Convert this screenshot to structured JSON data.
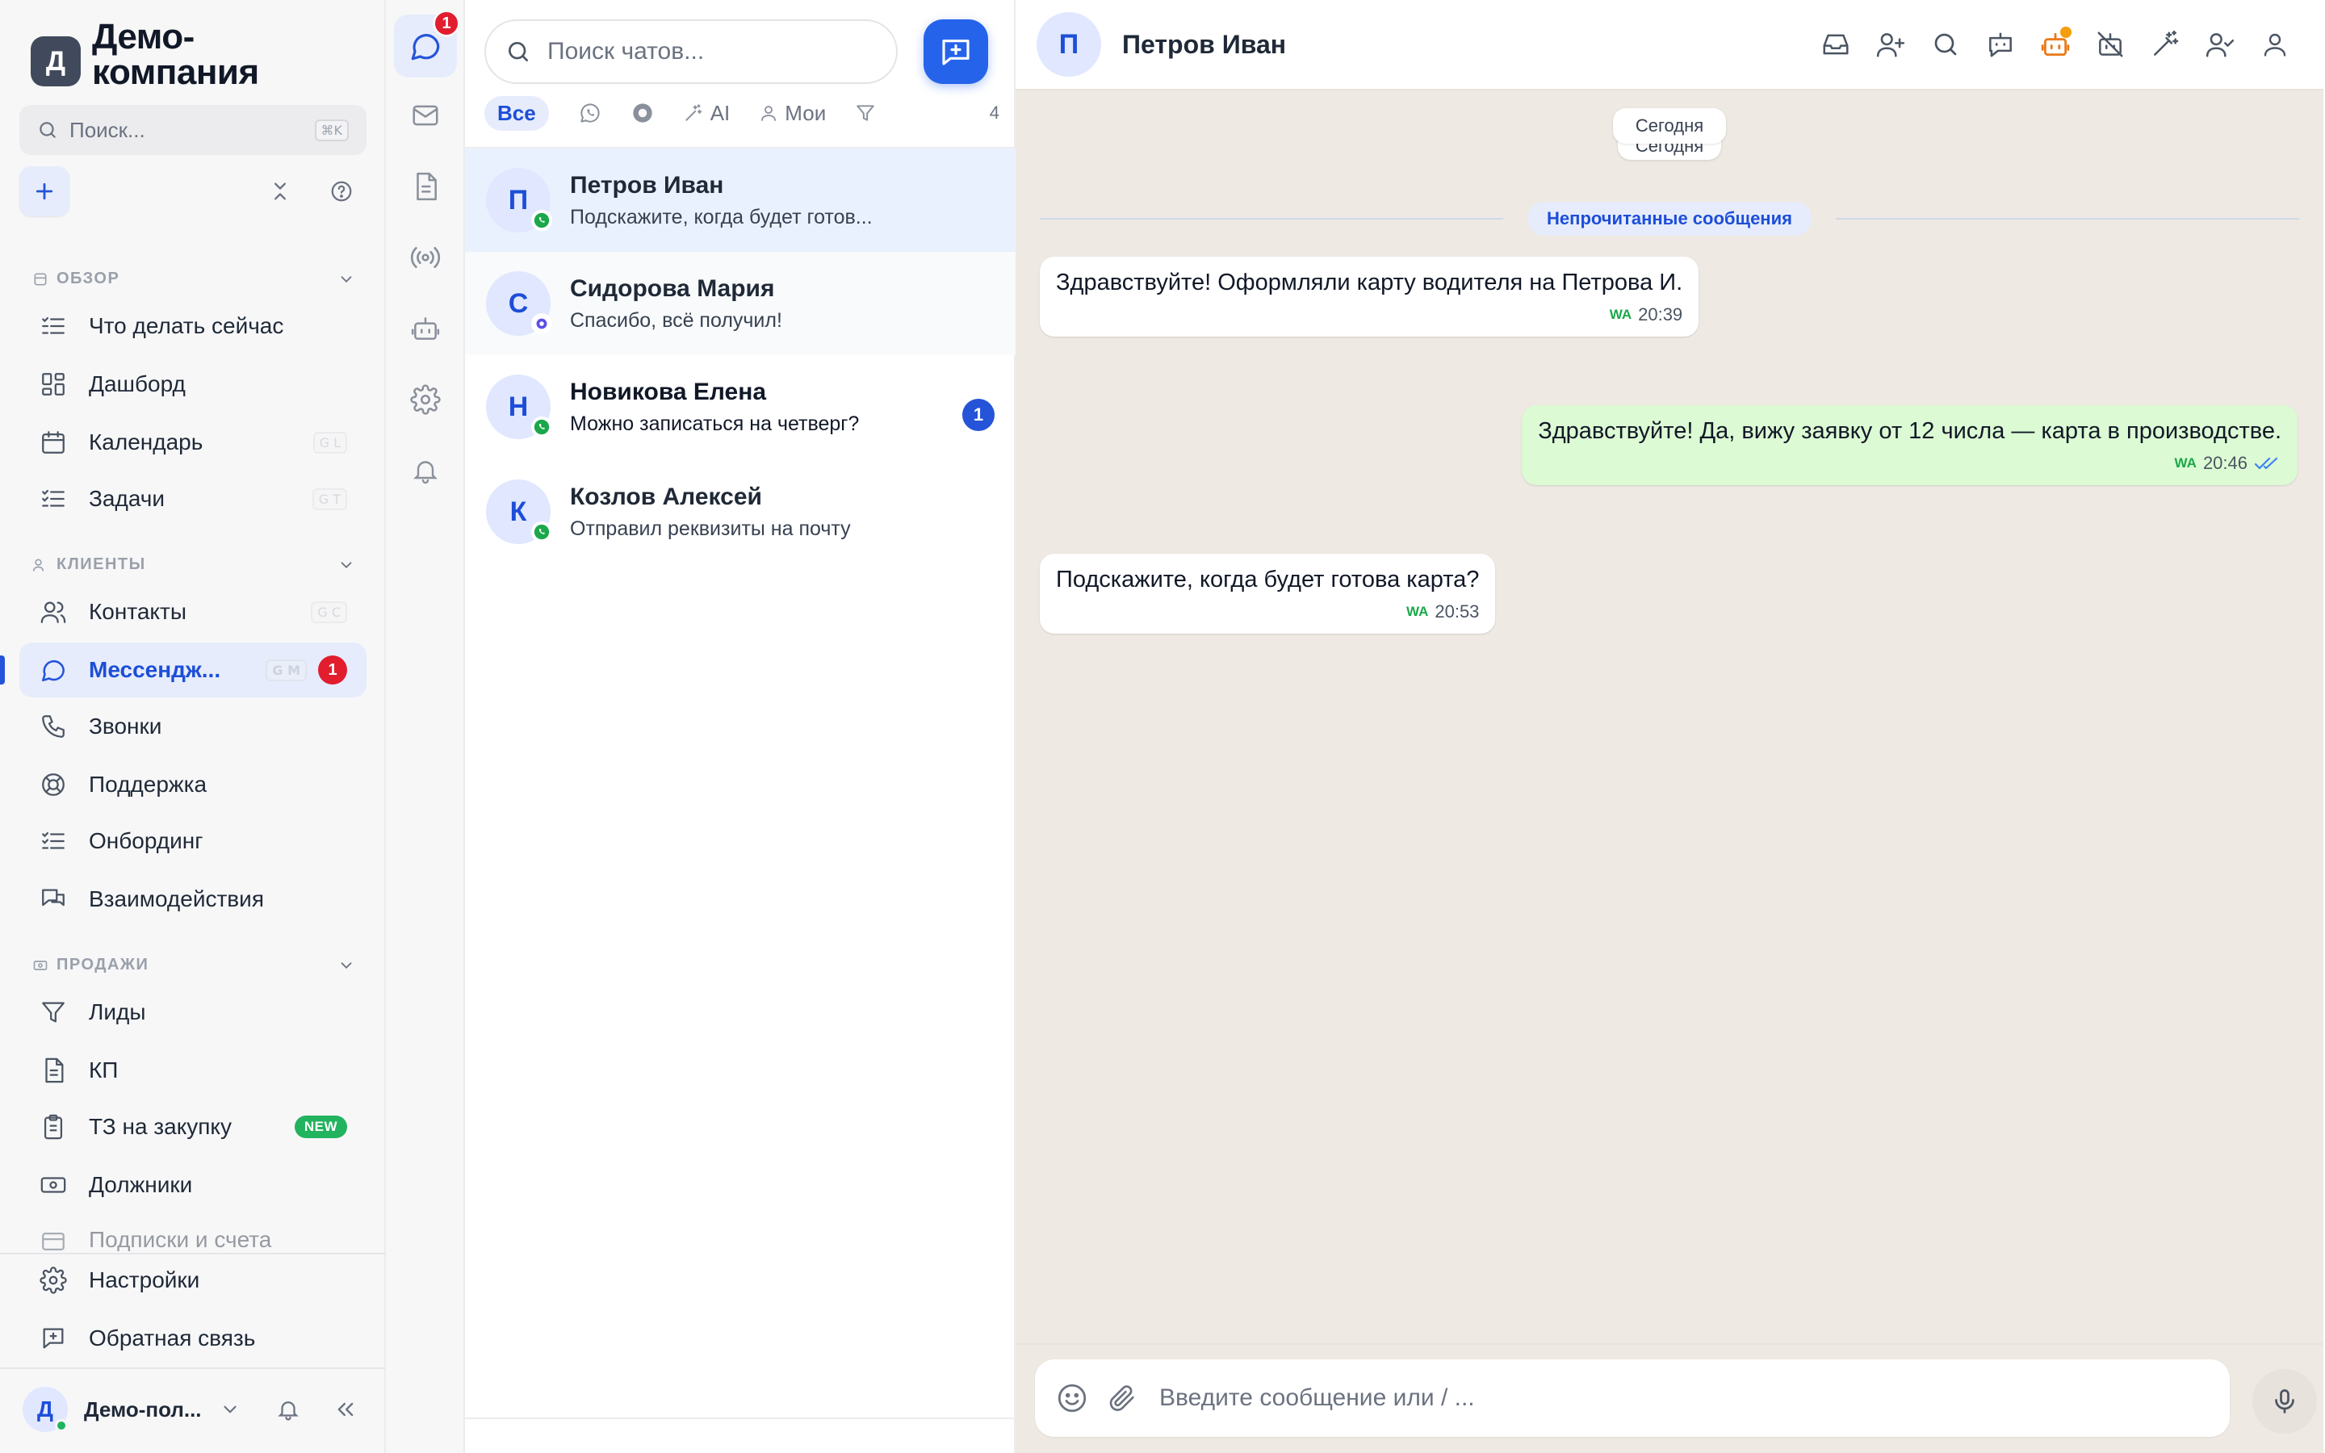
{
  "brand": {
    "logo_letter": "Д",
    "name": "Демо-компания"
  },
  "sidebar": {
    "search_label": "Поиск...",
    "search_shortcut": "⌘K",
    "sections": [
      {
        "title": "ОБЗОР",
        "items": [
          {
            "label": "Что делать сейчас",
            "icon": "list-todo-icon"
          },
          {
            "label": "Дашборд",
            "icon": "dashboard-icon"
          },
          {
            "label": "Календарь",
            "icon": "calendar-icon",
            "shortcut": "G L"
          },
          {
            "label": "Задачи",
            "icon": "tasks-icon",
            "shortcut": "G T"
          }
        ]
      },
      {
        "title": "КЛИЕНТЫ",
        "items": [
          {
            "label": "Контакты",
            "icon": "contacts-icon",
            "shortcut": "G C"
          },
          {
            "label": "Мессендж...",
            "icon": "chat-icon",
            "shortcut": "G M",
            "badge": "1",
            "active": true
          },
          {
            "label": "Звонки",
            "icon": "phone-icon"
          },
          {
            "label": "Поддержка",
            "icon": "lifebuoy-icon"
          },
          {
            "label": "Онбординг",
            "icon": "checklist-icon"
          },
          {
            "label": "Взаимодействия",
            "icon": "interactions-icon"
          }
        ]
      },
      {
        "title": "ПРОДАЖИ",
        "items": [
          {
            "label": "Лиды",
            "icon": "filter-icon"
          },
          {
            "label": "КП",
            "icon": "document-icon"
          },
          {
            "label": "ТЗ на закупку",
            "icon": "clipboard-icon",
            "badge": "NEW"
          },
          {
            "label": "Должники",
            "icon": "money-icon"
          },
          {
            "label": "Подписки и счета",
            "icon": "subscription-icon"
          }
        ]
      }
    ],
    "bottom_items": [
      {
        "label": "Настройки",
        "icon": "gear-icon"
      },
      {
        "label": "Обратная связь",
        "icon": "feedback-icon"
      }
    ],
    "user": {
      "avatar_letter": "Д",
      "name": "Демо-пол..."
    }
  },
  "rail": {
    "messenger_badge": "1"
  },
  "chatlist": {
    "search_placeholder": "Поиск чатов...",
    "filters": {
      "all": "Все",
      "ai": "AI",
      "mine": "Мои",
      "count": "4"
    },
    "chats": [
      {
        "avatar": "П",
        "name": "Петров Иван",
        "preview": "Подскажите, когда будет готов...",
        "channel": "whatsapp",
        "selected": true
      },
      {
        "avatar": "С",
        "name": "Сидорова Мария",
        "preview": "Спасибо, всё получил!",
        "channel": "max"
      },
      {
        "avatar": "Н",
        "name": "Новикова Елена",
        "preview": "Можно записаться на четверг?",
        "channel": "whatsapp",
        "unread": "1"
      },
      {
        "avatar": "К",
        "name": "Козлов Алексей",
        "preview": "Отправил реквизиты на почту",
        "channel": "whatsapp"
      }
    ]
  },
  "conversation": {
    "avatar": "П",
    "name": "Петров Иван",
    "date_label": "Сегодня",
    "unread_label": "Непрочитанные сообщения",
    "messages": [
      {
        "direction": "in",
        "text": "Здравствуйте! Оформляли карту водителя на Петрова И.",
        "channel_tag": "WA",
        "time": "20:39"
      },
      {
        "direction": "out",
        "text": "Здравствуйте! Да, вижу заявку от 12 числа — карта в производстве.",
        "channel_tag": "WA",
        "time": "20:46",
        "read": true
      },
      {
        "direction": "in",
        "text": "Подскажите, когда будет готова карта?",
        "channel_tag": "WA",
        "time": "20:53"
      }
    ],
    "composer_placeholder": "Введите сообщение или / ..."
  },
  "colors": {
    "accent": "#2554d8",
    "whatsapp": "#1ba84a",
    "danger": "#e11d2e",
    "outgoing_bubble": "#dcfad3",
    "chat_bg": "#efe9e3"
  }
}
